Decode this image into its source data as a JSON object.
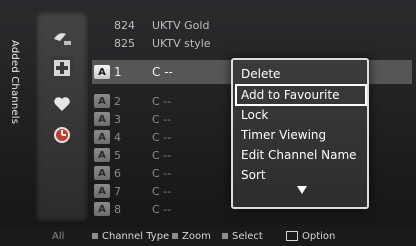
{
  "sidebar": {
    "title": "Added Channels",
    "icons": [
      "antenna-icon",
      "add-channel-icon",
      "favourite-heart-icon",
      "clock-icon"
    ]
  },
  "channels": [
    {
      "badge": "",
      "number": "824",
      "name": "UKTV Gold"
    },
    {
      "badge": "",
      "number": "825",
      "name": "UKTV style"
    },
    {
      "badge": "A",
      "number": "1",
      "name": "C --"
    },
    {
      "badge": "A",
      "number": "2",
      "name": "C --"
    },
    {
      "badge": "A",
      "number": "3",
      "name": "C --"
    },
    {
      "badge": "A",
      "number": "4",
      "name": "C --"
    },
    {
      "badge": "A",
      "number": "5",
      "name": "C --"
    },
    {
      "badge": "A",
      "number": "6",
      "name": "C --"
    },
    {
      "badge": "A",
      "number": "7",
      "name": "C --"
    },
    {
      "badge": "A",
      "number": "8",
      "name": "C --"
    }
  ],
  "popup_menu": {
    "items": [
      "Delete",
      "Add to Favourite",
      "Lock",
      "Timer Viewing",
      "Edit Channel Name",
      "Sort"
    ],
    "focused_item": "Add to Favourite",
    "more_indicator": "down-triangle-icon"
  },
  "bottom_bar": {
    "tab": "All",
    "help": [
      {
        "icon": "square-icon",
        "label": "Channel Type"
      },
      {
        "icon": "square-icon",
        "label": "Zoom"
      },
      {
        "icon": "square-icon",
        "label": "Select"
      },
      {
        "icon": "remote-icon",
        "label": "Option"
      }
    ]
  }
}
